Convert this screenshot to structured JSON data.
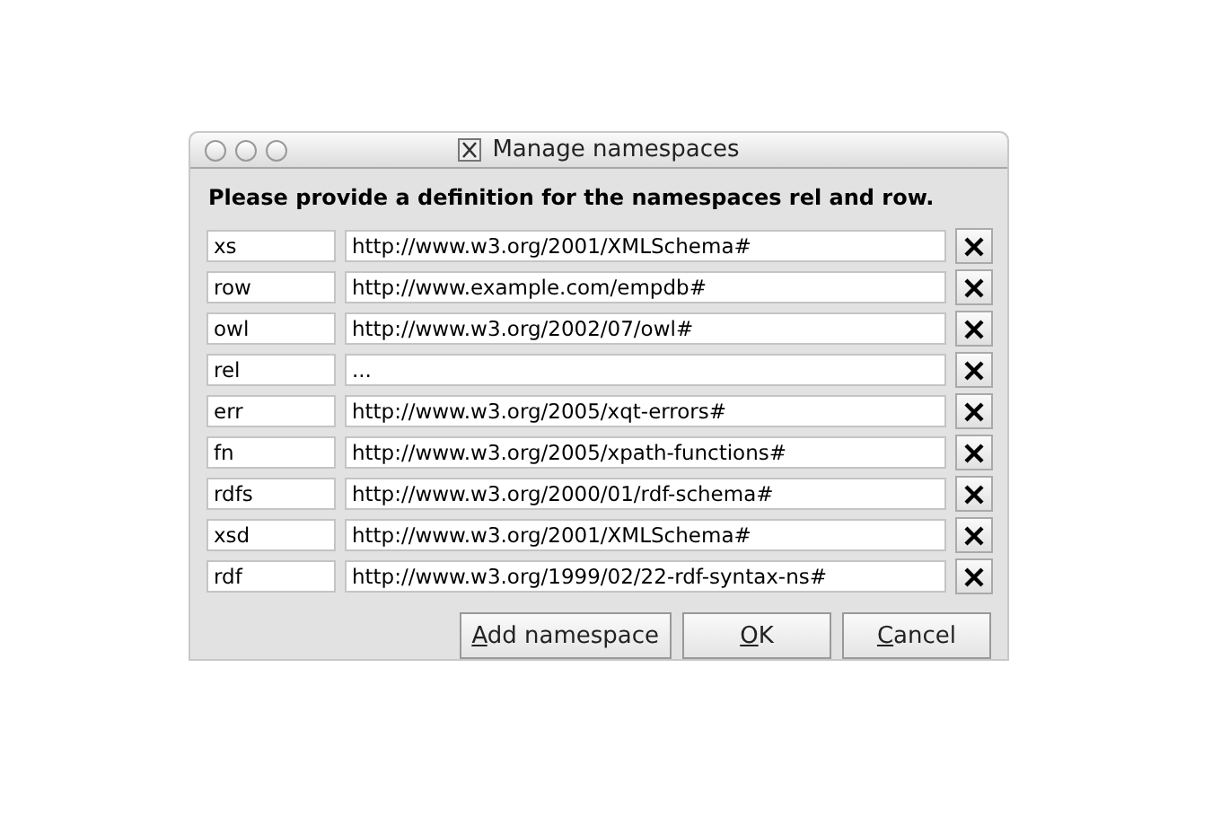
{
  "window": {
    "title": "Manage namespaces"
  },
  "message": "Please provide a definition for the namespaces rel and row.",
  "namespaces": [
    {
      "prefix": "xs",
      "uri": "http://www.w3.org/2001/XMLSchema#"
    },
    {
      "prefix": "row",
      "uri": "http://www.example.com/empdb#"
    },
    {
      "prefix": "owl",
      "uri": "http://www.w3.org/2002/07/owl#"
    },
    {
      "prefix": "rel",
      "uri": "..."
    },
    {
      "prefix": "err",
      "uri": "http://www.w3.org/2005/xqt-errors#"
    },
    {
      "prefix": "fn",
      "uri": "http://www.w3.org/2005/xpath-functions#"
    },
    {
      "prefix": "rdfs",
      "uri": "http://www.w3.org/2000/01/rdf-schema#"
    },
    {
      "prefix": "xsd",
      "uri": "http://www.w3.org/2001/XMLSchema#"
    },
    {
      "prefix": "rdf",
      "uri": "http://www.w3.org/1999/02/22-rdf-syntax-ns#"
    }
  ],
  "buttons": [
    {
      "label": "Add namespace",
      "mnemonic": true
    },
    {
      "label": "OK",
      "mnemonic": true
    },
    {
      "label": "Cancel",
      "mnemonic": true
    }
  ]
}
